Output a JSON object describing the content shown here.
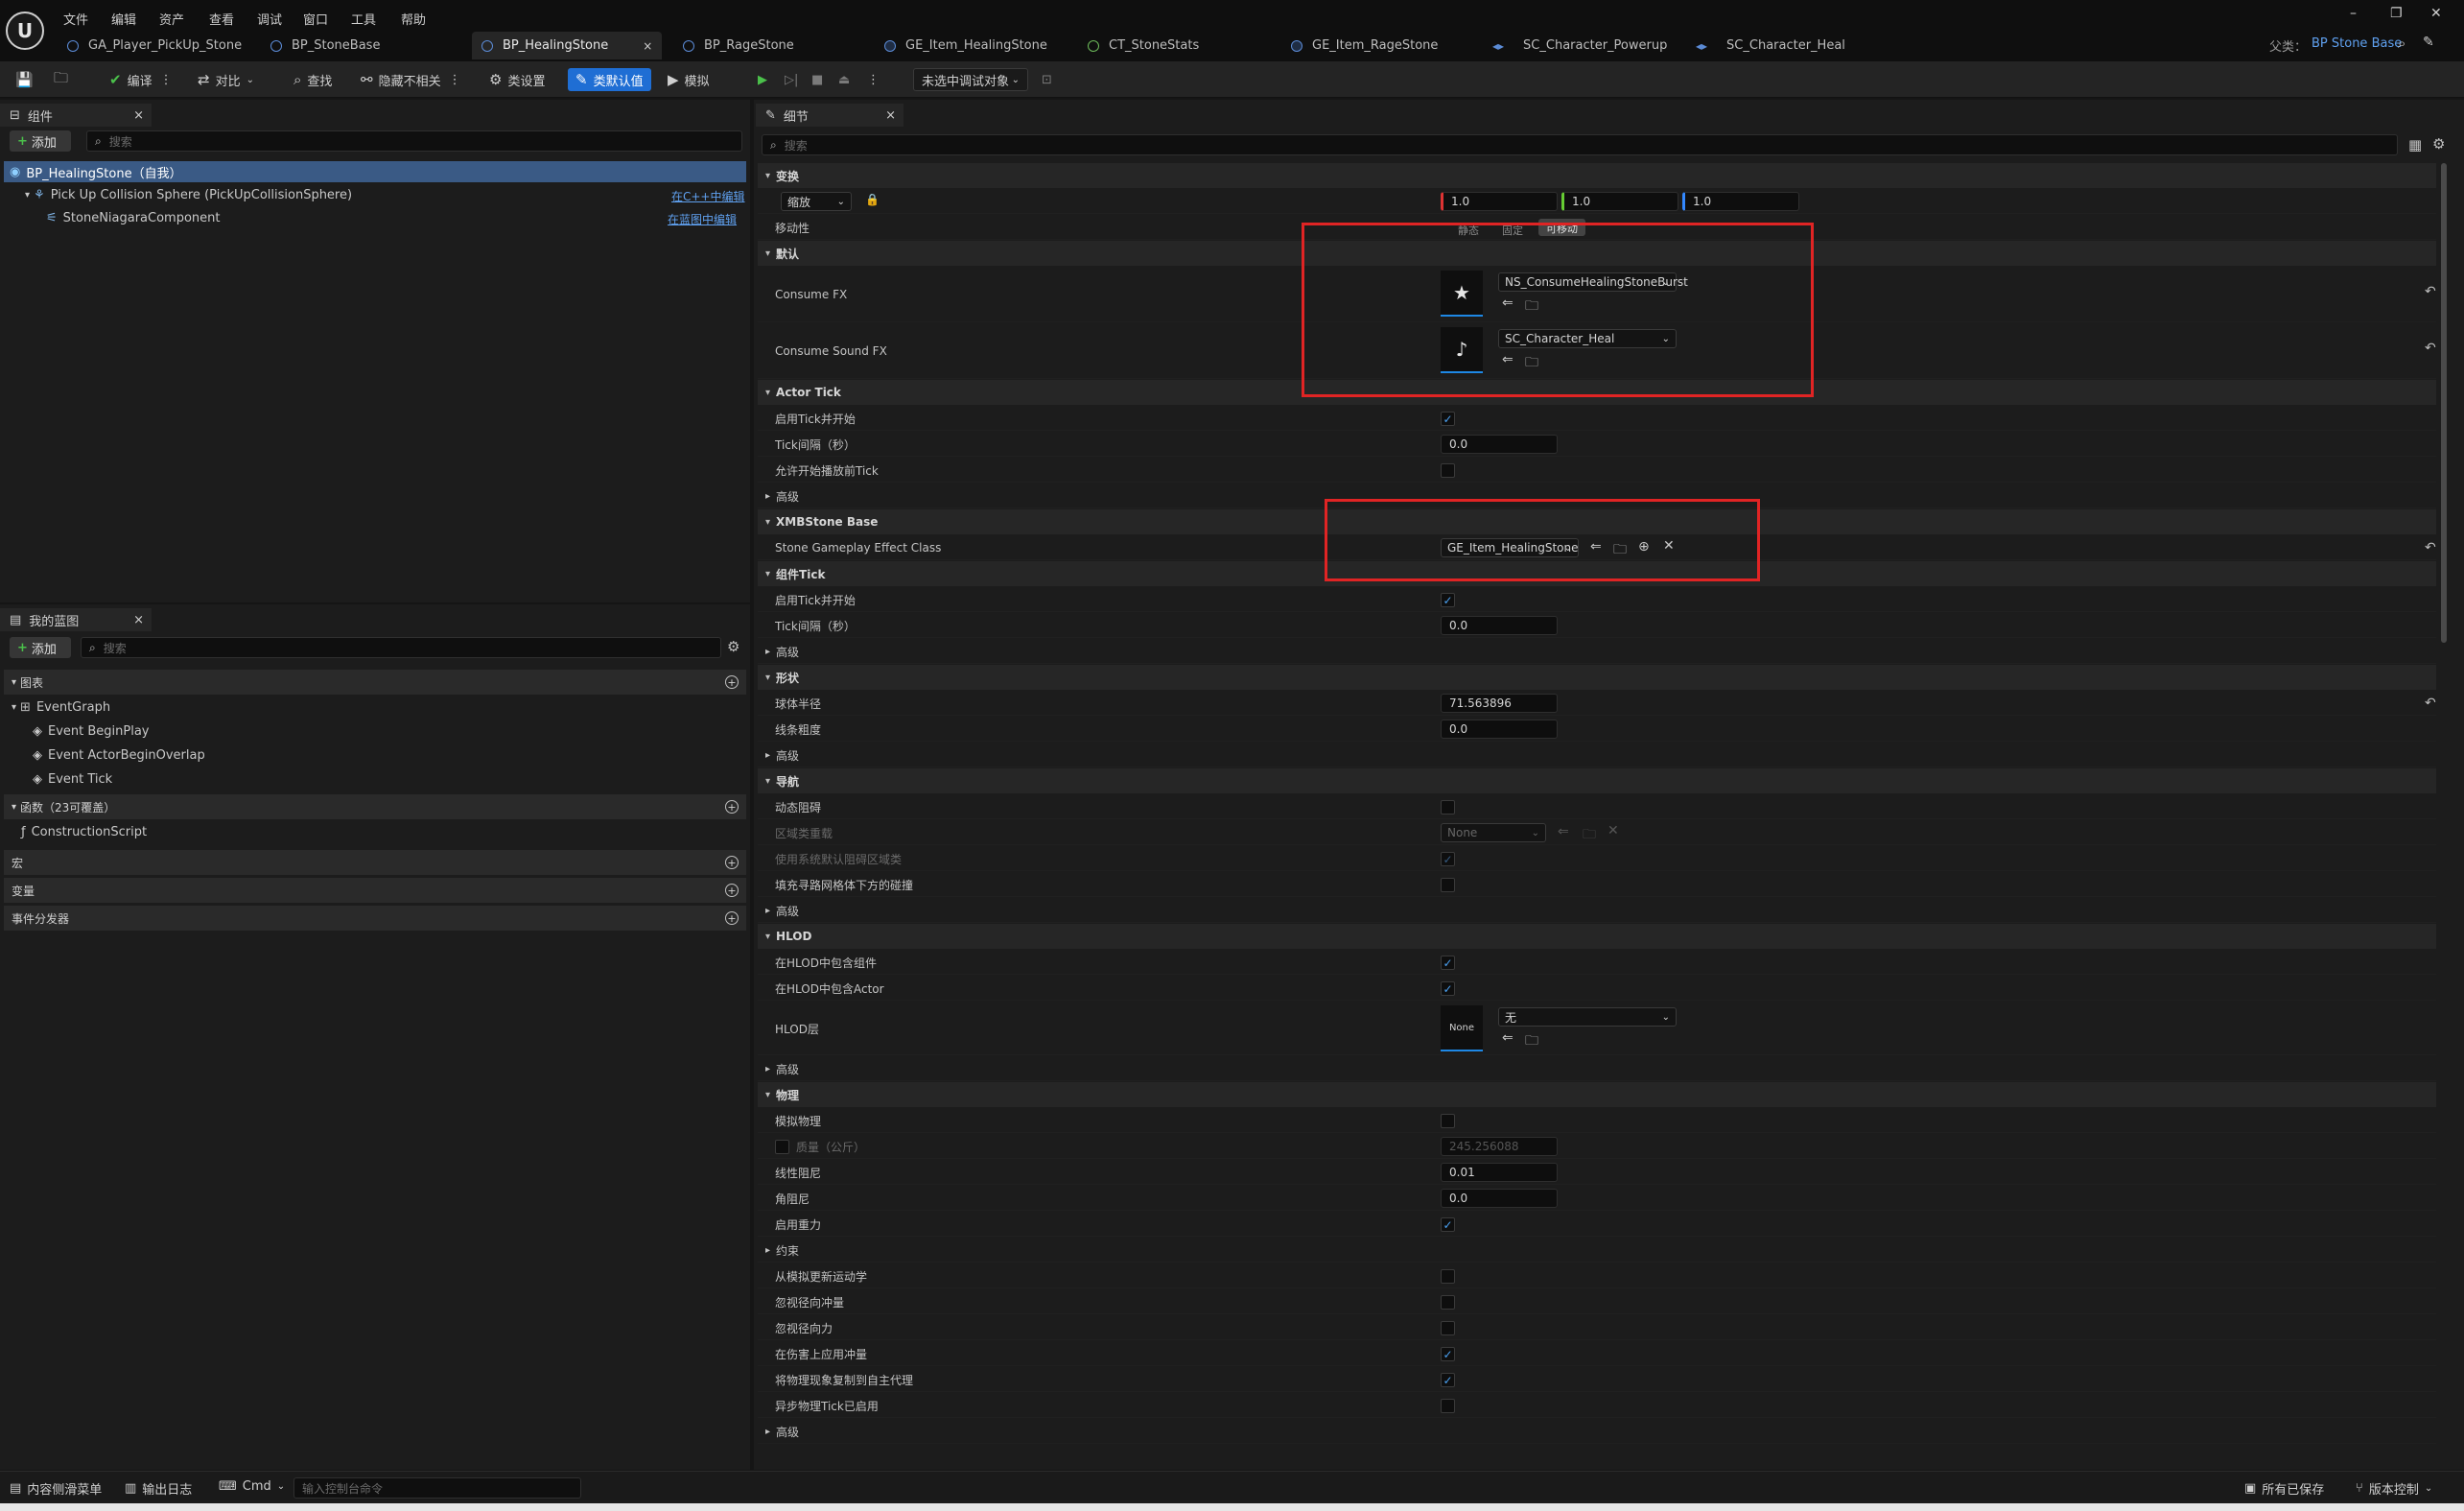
{
  "menu": [
    "文件",
    "编辑",
    "资产",
    "查看",
    "调试",
    "窗口",
    "工具",
    "帮助"
  ],
  "tabs": [
    "GA_Player_PickUp_Stone",
    "BP_StoneBase",
    "BP_HealingStone",
    "BP_RageStone",
    "GE_Item_HealingStone",
    "CT_StoneStats",
    "GE_Item_RageStone",
    "SC_Character_Powerup",
    "SC_Character_Heal"
  ],
  "tab_close": "×",
  "parent_label": "父类：",
  "parent_value": "BP Stone Base",
  "toolbar": {
    "compile": "编译",
    "diff": "对比",
    "find": "查找",
    "hide_unrelated": "隐藏不相关",
    "class_settings": "类设置",
    "class_defaults": "类默认值",
    "simulate": "模拟",
    "debug_target": "未选中调试对象"
  },
  "components": {
    "tab_title": "组件",
    "add": "添加",
    "search_placeholder": "搜索",
    "tree": [
      {
        "label": "BP_HealingStone（自我）"
      },
      {
        "label": "Pick Up Collision Sphere (PickUpCollisionSphere)",
        "link": "在C++中编辑"
      },
      {
        "label": "StoneNiagaraComponent",
        "link": "在蓝图中编辑"
      }
    ]
  },
  "myblueprint": {
    "tab_title": "我的蓝图",
    "add": "添加",
    "search_placeholder": "搜索",
    "graphs_label": "图表",
    "event_graph": "EventGraph",
    "events": [
      "Event BeginPlay",
      "Event ActorBeginOverlap",
      "Event Tick"
    ],
    "functions_label": "函数（23可覆盖）",
    "construction_script": "ConstructionScript",
    "macros_label": "宏",
    "variables_label": "变量",
    "dispatchers_label": "事件分发器"
  },
  "details": {
    "tab_title": "细节",
    "search_placeholder": "搜索",
    "transform": {
      "section": "变换",
      "scale_label": "缩放",
      "scale": [
        "1.0",
        "1.0",
        "1.0"
      ],
      "mobility_label": "移动性",
      "mobility_options": [
        "静态",
        "固定",
        "可移动"
      ]
    },
    "default": {
      "section": "默认",
      "consume_fx_label": "Consume FX",
      "consume_fx_value": "NS_ConsumeHealingStoneBurst",
      "consume_sound_label": "Consume Sound FX",
      "consume_sound_value": "SC_Character_Heal"
    },
    "actor_tick": {
      "section": "Actor Tick",
      "start_enabled": "启用Tick并开始",
      "interval_label": "Tick间隔（秒）",
      "interval": "0.0",
      "allow_before_play": "允许开始播放前Tick",
      "advanced": "高级"
    },
    "xmb": {
      "section": "XMBStone Base",
      "effect_class_label": "Stone Gameplay Effect Class",
      "effect_class_value": "GE_Item_HealingStone"
    },
    "component_tick": {
      "section": "组件Tick",
      "start_enabled": "启用Tick并开始",
      "interval_label": "Tick间隔（秒）",
      "interval": "0.0",
      "advanced": "高级"
    },
    "shape": {
      "section": "形状",
      "sphere_radius_label": "球体半径",
      "sphere_radius": "71.563896",
      "line_thickness_label": "线条粗度",
      "line_thickness": "0.0",
      "advanced": "高级"
    },
    "navigation": {
      "section": "导航",
      "dynamic_obstacle": "动态阻碍",
      "area_class_label": "区域类重载",
      "area_class_value": "None",
      "use_default_area": "使用系统默认阻碍区域类",
      "fill_collision": "填充寻路网格体下方的碰撞",
      "advanced": "高级"
    },
    "hlod": {
      "section": "HLOD",
      "include_component": "在HLOD中包含组件",
      "include_actor": "在HLOD中包含Actor",
      "layer_label": "HLOD层",
      "layer_thumb": "None",
      "layer_value": "无",
      "advanced": "高级"
    },
    "physics": {
      "section": "物理",
      "simulate": "模拟物理",
      "mass_label": "质量（公斤）",
      "mass": "245.256088",
      "linear_damping_label": "线性阻尼",
      "linear_damping": "0.01",
      "angular_damping_label": "角阻尼",
      "angular_damping": "0.0",
      "gravity": "启用重力",
      "constraints": "约束",
      "update_kinematic": "从模拟更新运动学",
      "ignore_radial_impulse": "忽视径向冲量",
      "ignore_radial_force": "忽视径向力",
      "apply_impulse_on_damage": "在伤害上应用冲量",
      "replicate_to_autonomous": "将物理现象复制到自主代理",
      "async_tick": "异步物理Tick已启用",
      "advanced": "高级"
    }
  },
  "statusbar": {
    "content_drawer": "内容侧滑菜单",
    "output_log": "输出日志",
    "cmd": "Cmd",
    "console_placeholder": "输入控制台命令",
    "all_saved": "所有已保存",
    "source_control": "版本控制"
  }
}
